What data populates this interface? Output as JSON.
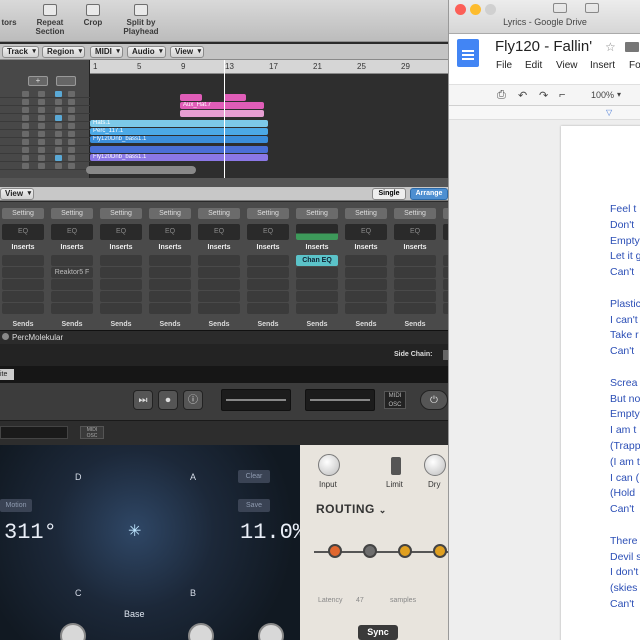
{
  "logic": {
    "toolbar": [
      {
        "label": "tors"
      },
      {
        "label": "Repeat Section"
      },
      {
        "label": "Crop"
      },
      {
        "label": "Split by Playhead"
      }
    ],
    "menus": [
      "Track",
      "Region",
      "MIDI",
      "Audio",
      "View"
    ],
    "ruler_numbers": [
      "1",
      "5",
      "9",
      "13",
      "17",
      "21",
      "25",
      "29"
    ],
    "regions": [
      {
        "label": "Aux_Hat.7",
        "color": "#e05db8"
      },
      {
        "label": "Hats.1",
        "color": "#7cc9e8"
      },
      {
        "label": "Perc_117.1",
        "color": "#4ca9e6"
      },
      {
        "label": "Fly120Dnb_bass1.1",
        "color": "#3b8edb"
      },
      {
        "label": "Fly120Dnb_bass1.1",
        "color": "#8b78e6"
      }
    ],
    "view_menu": "View",
    "mixer_tabs": [
      "Single",
      "Arrange"
    ],
    "strip_setting": "Setting",
    "strip_eq": "EQ",
    "strip_inserts": "Inserts",
    "strip_sends": "Sends",
    "plugins": [
      "Reaktor5 F",
      "Chan EQ"
    ],
    "plugin_name": "PercMolekular",
    "side_chain": "Side Chain:",
    "ite": "ite",
    "pad": {
      "letters": [
        "D",
        "A",
        "C",
        "B"
      ],
      "left_value": "311°",
      "right_value": "11.0%",
      "motion": "Motion",
      "clear": "Clear",
      "save": "Save",
      "base": "Base"
    },
    "routing": {
      "input": "Input",
      "limit": "Limit",
      "dry": "Dry",
      "title": "ROUTING",
      "latency": "Latency",
      "latency_value": "47",
      "samples": "samples",
      "sync": "Sync",
      "nodes": [
        "#e0672f",
        "#6e6e6e",
        "#e0a020",
        "#e0a020"
      ]
    }
  },
  "drive": {
    "window_title": "Lyrics - Google Drive",
    "doc_title": "Fly120 - Fallin'",
    "menu": [
      "File",
      "Edit",
      "View",
      "Insert",
      "Fo"
    ],
    "zoom": "100%",
    "lyrics": [
      "Feel t",
      "Don't",
      "Empty",
      "Let it g",
      "Can't",
      "Plastic",
      "I can't",
      "Take r",
      "Can't",
      "Screa",
      "But no",
      "Empty",
      "I am t",
      "(Trapp",
      "(I am t",
      "I can (",
      "(Hold",
      "Can't",
      "There",
      "Devil s",
      "I don't",
      "(skies",
      "Can't"
    ]
  }
}
